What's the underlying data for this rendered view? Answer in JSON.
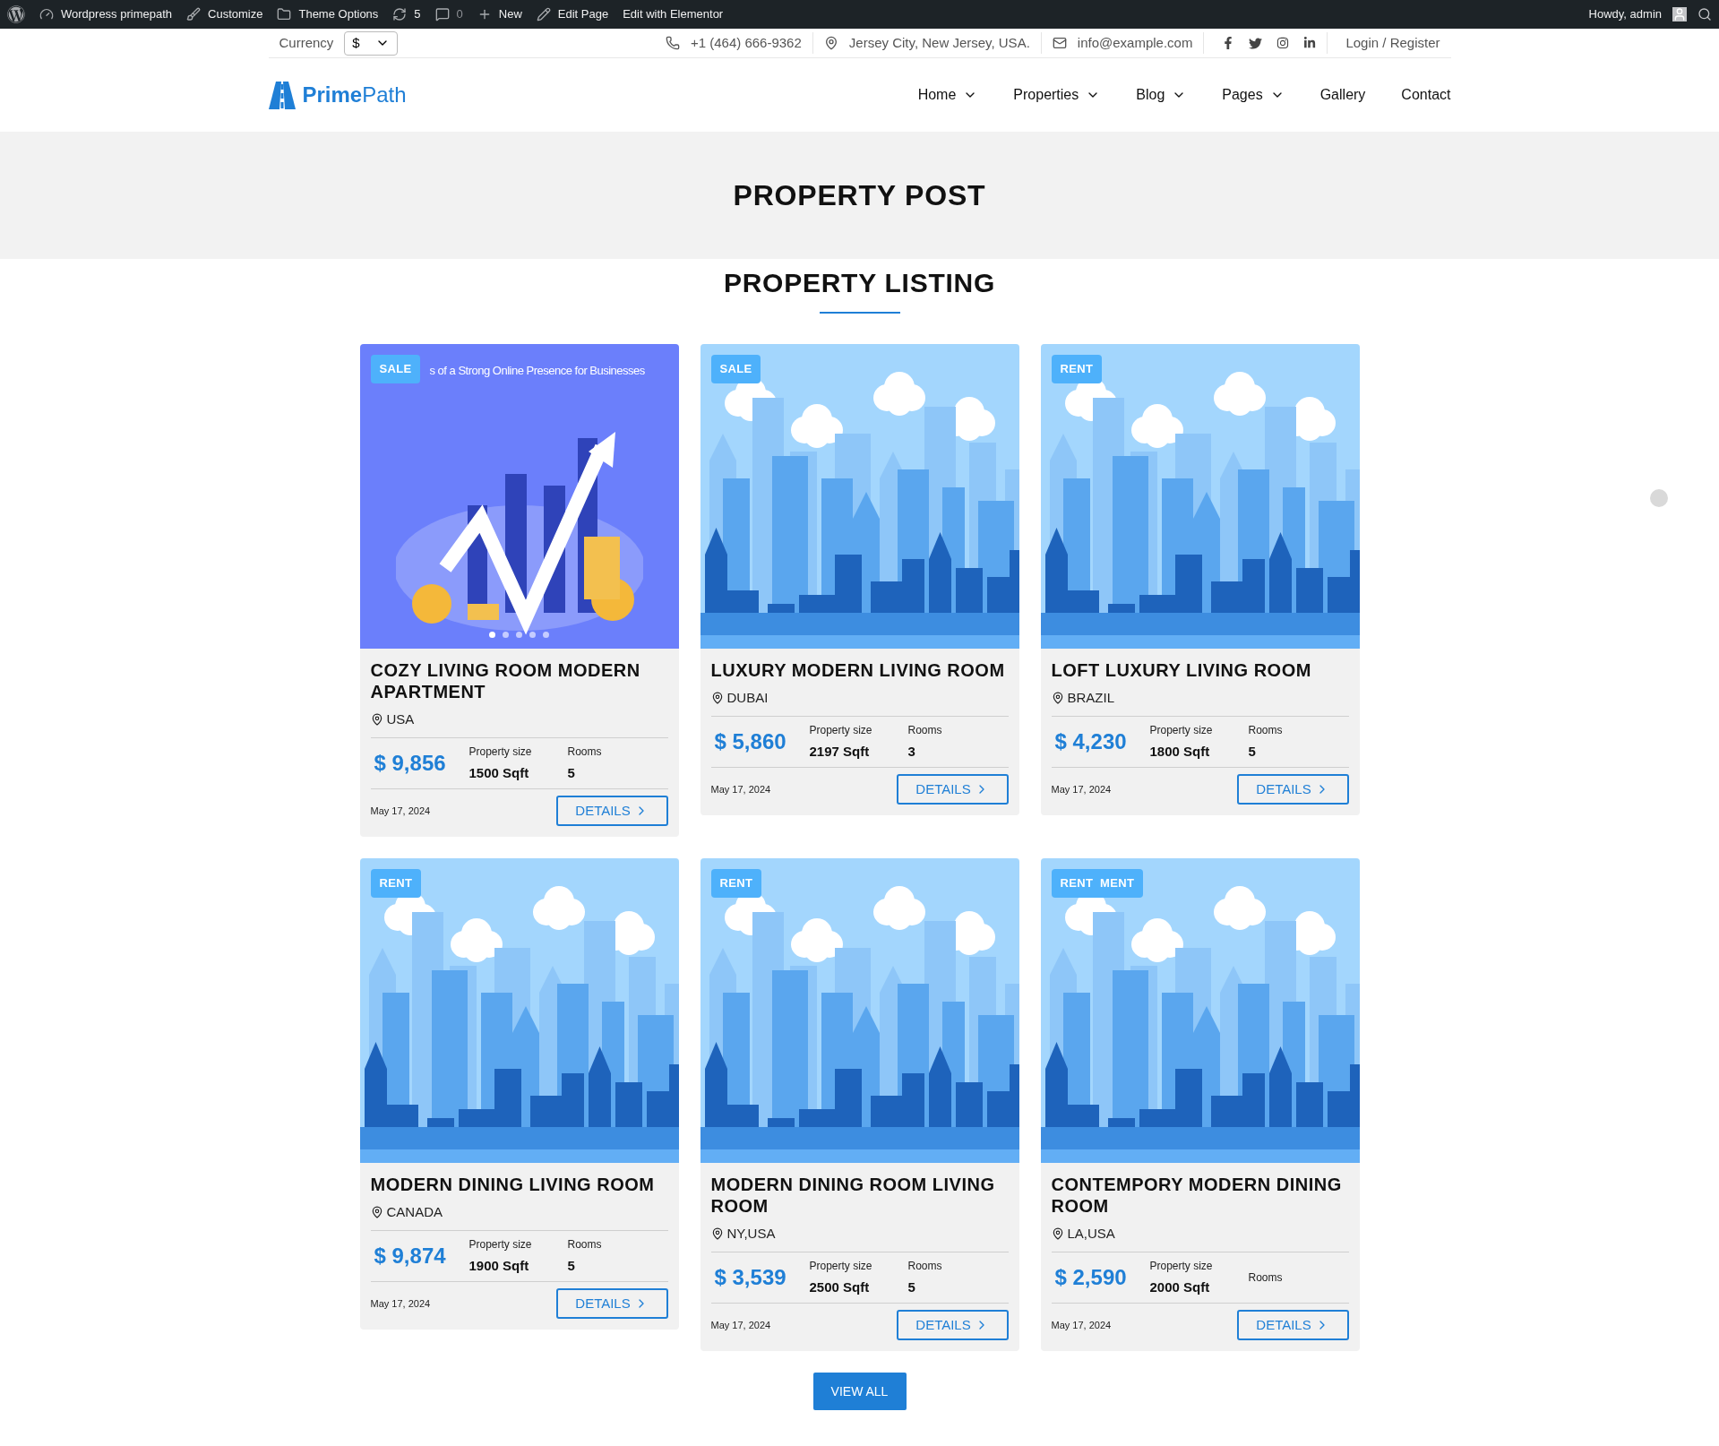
{
  "admin_bar": {
    "items": [
      {
        "kind": "wordpress"
      },
      {
        "kind": "dashboard",
        "label": "Wordpress primepath"
      },
      {
        "kind": "brush",
        "label": "Customize"
      },
      {
        "kind": "folder",
        "label": "Theme Options"
      },
      {
        "kind": "sync",
        "label": "5"
      },
      {
        "kind": "comment",
        "label": "0"
      },
      {
        "kind": "plus",
        "label": "New"
      },
      {
        "kind": "pencil",
        "label": "Edit Page"
      },
      {
        "kind": "text",
        "label": "Edit with Elementor"
      }
    ],
    "greeting": "Howdy, admin"
  },
  "top_bar": {
    "currency_label": "Currency",
    "currency_value": "$",
    "phone": "+1 (464) 666-9362",
    "address": "Jersey City, New Jersey, USA.",
    "email": "info@example.com",
    "login": "Login / Register"
  },
  "logo": {
    "bold": "Prime",
    "light": "Path"
  },
  "menu": [
    {
      "label": "Home",
      "has_dropdown": true
    },
    {
      "label": "Properties",
      "has_dropdown": true
    },
    {
      "label": "Blog",
      "has_dropdown": true
    },
    {
      "label": "Pages",
      "has_dropdown": true
    },
    {
      "label": "Gallery",
      "has_dropdown": false
    },
    {
      "label": "Contact",
      "has_dropdown": false
    }
  ],
  "banner_title": "PROPERTY POST",
  "section_title": "PROPERTY LISTING",
  "properties": [
    {
      "kind": "illustration",
      "image_caption": "s of a Strong Online Presence for Businesses",
      "slides": [
        {
          "selected": true
        },
        {
          "selected": false
        },
        {
          "selected": false
        },
        {
          "selected": false
        },
        {
          "selected": false
        }
      ],
      "badge": "SALE",
      "title": "COZY LIVING ROOM MODERN APARTMENT",
      "location": "USA",
      "price": "$ 9,856",
      "size_label": "Property size",
      "size": "1500 Sqft",
      "rooms_label": "Rooms",
      "rooms": "5",
      "date": "May 17, 2024",
      "button": "DETAILS"
    },
    {
      "kind": "skyline",
      "badge": "SALE",
      "title": "LUXURY MODERN LIVING ROOM",
      "location": "DUBAI",
      "price": "$ 5,860",
      "size_label": "Property size",
      "size": "2197 Sqft",
      "rooms_label": "Rooms",
      "rooms": "3",
      "date": "May 17, 2024",
      "button": "DETAILS"
    },
    {
      "kind": "skyline",
      "badge": "RENT",
      "title": "LOFT LUXURY LIVING ROOM",
      "location": "BRAZIL",
      "price": "$ 4,230",
      "size_label": "Property size",
      "size": "1800 Sqft",
      "rooms_label": "Rooms",
      "rooms": "5",
      "date": "May 17, 2024",
      "button": "DETAILS"
    },
    {
      "kind": "skyline",
      "badge": "RENT",
      "title": "MODERN DINING LIVING ROOM",
      "location": "CANADA",
      "price": "$ 9,874",
      "size_label": "Property size",
      "size": "1900 Sqft",
      "rooms_label": "Rooms",
      "rooms": "5",
      "date": "May 17, 2024",
      "button": "DETAILS"
    },
    {
      "kind": "skyline",
      "badge": "RENT",
      "title": "MODERN DINING ROOM LIVING ROOM",
      "location": "NY,USA",
      "price": "$ 3,539",
      "size_label": "Property size",
      "size": "2500 Sqft",
      "rooms_label": "Rooms",
      "rooms": "5",
      "date": "May 17, 2024",
      "button": "DETAILS"
    },
    {
      "kind": "skyline",
      "badge": "RENT  MENT",
      "title": "CONTEMPORY MODERN DINING ROOM",
      "location": "LA,USA",
      "price": "$ 2,590",
      "size_label": "Property size",
      "size": "2000 Sqft",
      "rooms_label": "Rooms",
      "date": "May 17, 2024",
      "button": "DETAILS"
    }
  ],
  "view_all": "VIEW ALL"
}
